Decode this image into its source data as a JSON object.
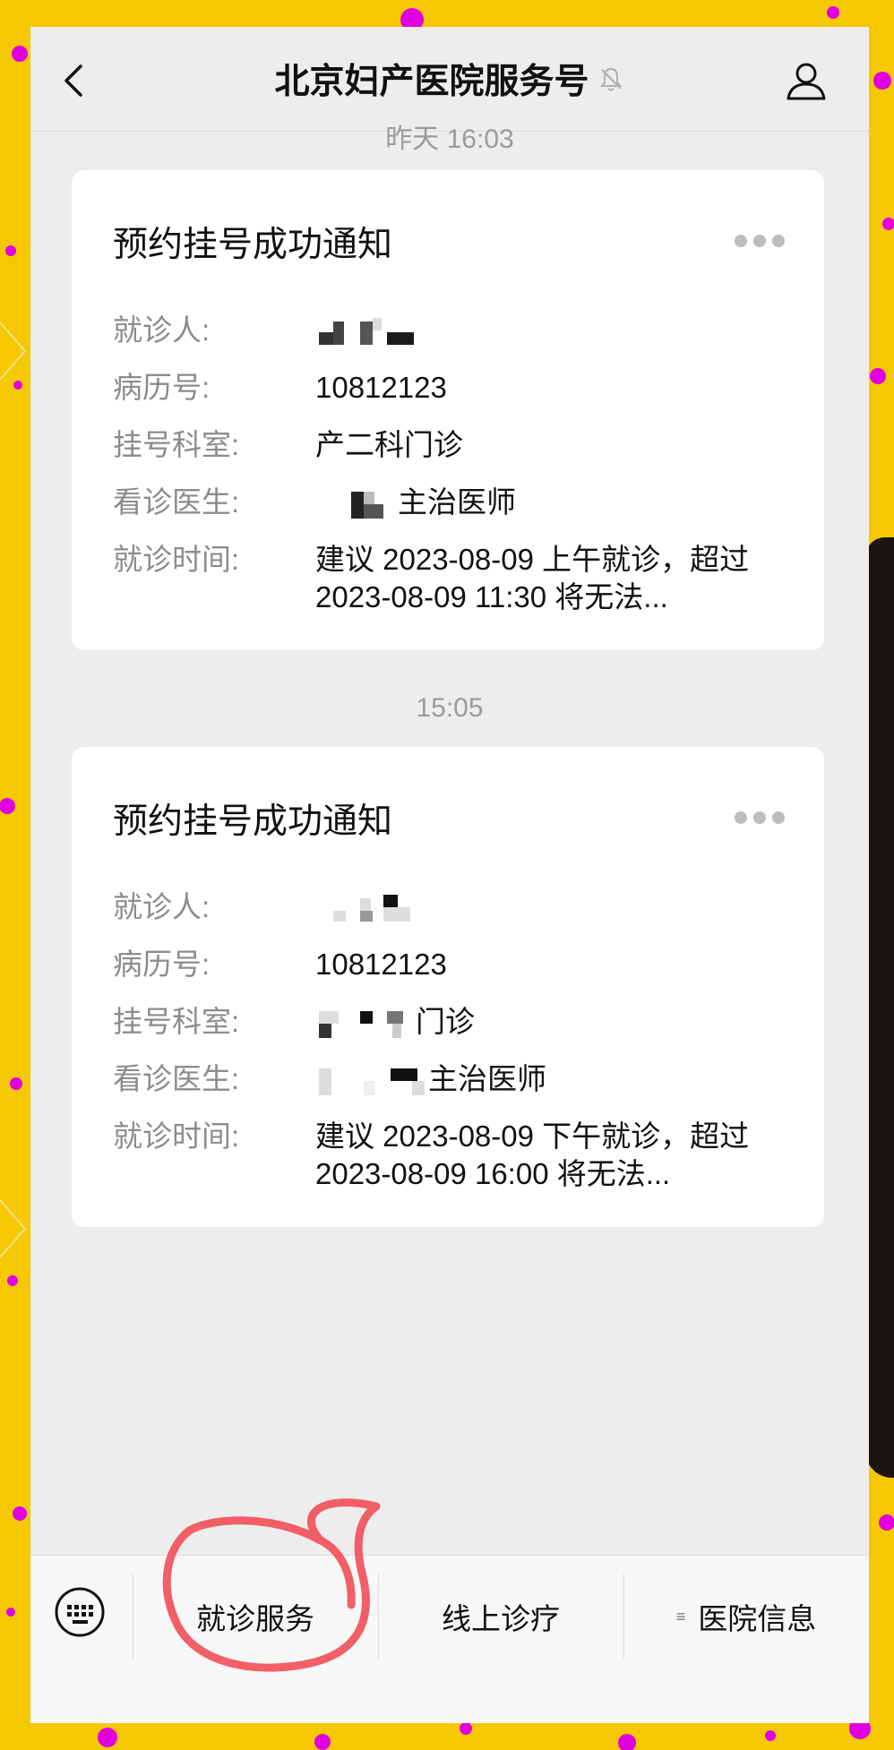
{
  "header": {
    "title": "北京妇产医院服务号",
    "back_icon": "chevron-left-icon",
    "mute_icon": "bell-slash-icon",
    "profile_icon": "person-icon"
  },
  "messages": [
    {
      "time": "昨天 16:03",
      "title": "预约挂号成功通知",
      "rows": [
        {
          "label": "就诊人:",
          "value": ""
        },
        {
          "label": "病历号:",
          "value": "10812123"
        },
        {
          "label": "挂号科室:",
          "value": "产二科门诊"
        },
        {
          "label": "看诊医生:",
          "value": "主治医师"
        },
        {
          "label": "就诊时间:",
          "value": "建议 2023-08-09 上午就诊，超过 2023-08-09  11:30 将无法..."
        }
      ]
    },
    {
      "time": "15:05",
      "title": "预约挂号成功通知",
      "rows": [
        {
          "label": "就诊人:",
          "value": ""
        },
        {
          "label": "病历号:",
          "value": "10812123"
        },
        {
          "label": "挂号科室:",
          "value": "门诊"
        },
        {
          "label": "看诊医生:",
          "value": "主治医师"
        },
        {
          "label": "就诊时间:",
          "value": "建议 2023-08-09 下午就诊，超过 2023-08-09  16:00 将无法..."
        }
      ]
    }
  ],
  "menu": {
    "keyboard_icon": "keyboard-icon",
    "items": [
      {
        "label": "就诊服务"
      },
      {
        "label": "线上诊疗"
      },
      {
        "label": "医院信息",
        "icon": "≡"
      }
    ]
  },
  "colors": {
    "background": "#F6C800",
    "dots": "#E000E0",
    "annotation": "#F0525A"
  }
}
